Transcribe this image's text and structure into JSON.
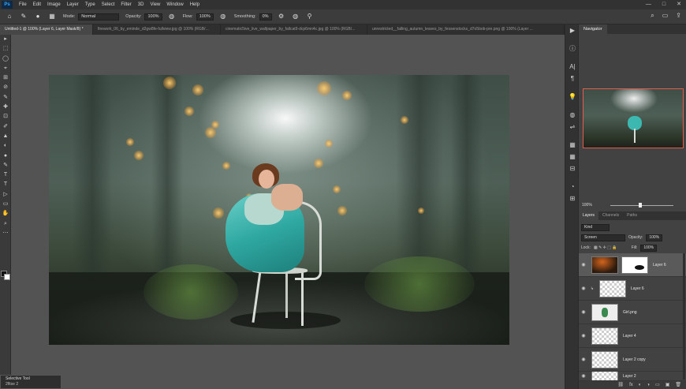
{
  "app": {
    "logo": "Ps"
  },
  "menu": [
    "File",
    "Edit",
    "Image",
    "Layer",
    "Type",
    "Select",
    "Filter",
    "3D",
    "View",
    "Window",
    "Help"
  ],
  "window_controls": [
    "—",
    "□",
    "✕"
  ],
  "options": {
    "mode_label": "Mode:",
    "mode_value": "Normal",
    "opacity_label": "Opacity:",
    "opacity_value": "100%",
    "flow_label": "Flow:",
    "flow_value": "100%",
    "smoothing_label": "Smoothing:",
    "smoothing_value": "0%"
  },
  "tabs": [
    {
      "label": "Untitled-1 @ 100% (Layer 6, Layer Mask/8) *",
      "active": true
    },
    {
      "label": "firework_06_by_eminde_d2gw8fe-fullview.jpg @ 100% (RGB/...",
      "active": false
    },
    {
      "label": "cinematic5ive_live_wallpaper_by_fallcat9-dcp6mn4c.jpg @ 100% (RGB/...",
      "active": false
    },
    {
      "label": "unrestricted__falling_autumn_leaves_by_fessenstocks_d7o5bob-pre.png @ 100% (Layer ...",
      "active": false
    }
  ],
  "tools": [
    "▸",
    "⬚",
    "◯",
    "⌖",
    "⊞",
    "⊘",
    "✎",
    "✚",
    "⊡",
    "✐",
    "▲",
    "◐",
    "●",
    "✎",
    "T",
    "▷",
    "▭",
    "✋",
    "⌕",
    "⋯"
  ],
  "selective_tool": {
    "title": "Selective Tool",
    "subtitle": "2fitse 2"
  },
  "panel_strip_icons": [
    "▶",
    "ⓘ",
    "A|",
    "¶",
    "💡",
    "◍",
    "⇌",
    "▦",
    "⊟",
    "◔",
    "⊞"
  ],
  "navigator": {
    "tab": "Navigator",
    "zoom": "100%"
  },
  "layers_panel": {
    "tabs": [
      "Layers",
      "Channels",
      "Paths"
    ],
    "filter_kind": "Kind",
    "blend_mode": "Screen",
    "opacity_label": "Opacity:",
    "opacity_value": "100%",
    "lock_label": "Lock:",
    "fill_label": "Fill:",
    "fill_value": "100%",
    "layers": [
      {
        "name": "Layer 6",
        "thumb": "fire",
        "mask": true,
        "selected": true
      },
      {
        "name": "Layer 6",
        "thumb": "checker",
        "mask": false,
        "selected": false
      },
      {
        "name": "Girl.png",
        "thumb": "girl",
        "mask": false,
        "selected": false
      },
      {
        "name": "Layer 4",
        "thumb": "checker",
        "mask": false,
        "selected": false
      },
      {
        "name": "Layer 2 copy",
        "thumb": "checker",
        "mask": false,
        "selected": false
      },
      {
        "name": "Layer 2",
        "thumb": "checker",
        "mask": false,
        "selected": false
      }
    ],
    "footer_icons": [
      "⛓",
      "fx",
      "◐",
      "◑",
      "▭",
      "▣",
      "🗑"
    ]
  }
}
